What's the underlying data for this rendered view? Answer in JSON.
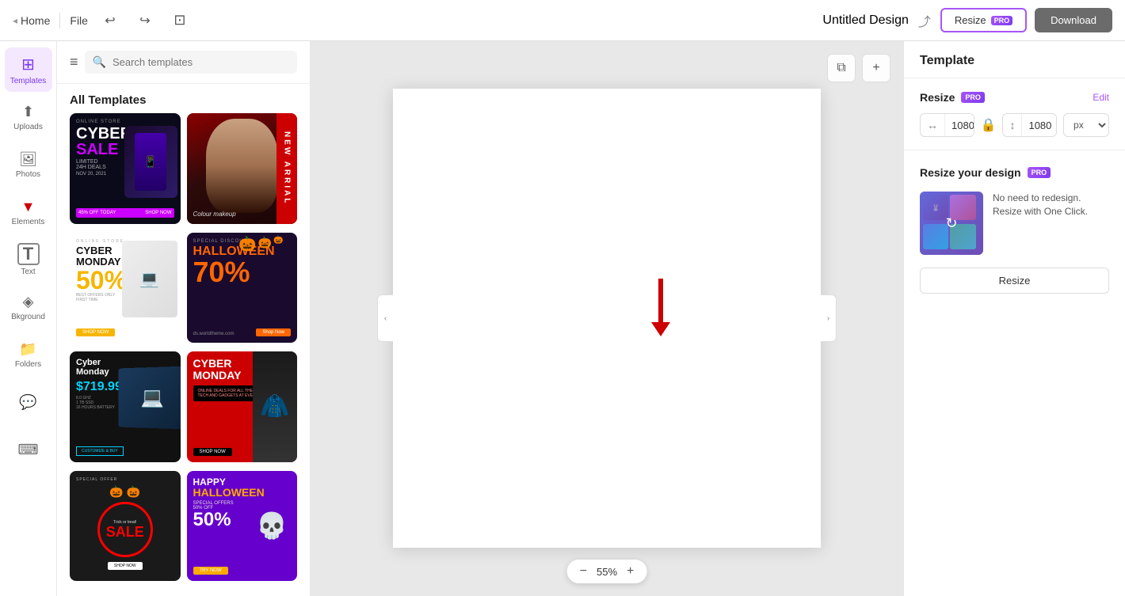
{
  "topbar": {
    "home_label": "Home",
    "file_label": "File",
    "undo_icon": "↩",
    "redo_icon": "↪",
    "doc_icon": "⬜",
    "title": "Untitled Design",
    "share_icon": "⤴",
    "resize_label": "Resize",
    "pro_badge": "PRO",
    "download_label": "Download"
  },
  "sidebar": {
    "items": [
      {
        "id": "templates",
        "label": "Templates",
        "icon": "⊞",
        "active": true
      },
      {
        "id": "uploads",
        "label": "Uploads",
        "icon": "↑"
      },
      {
        "id": "photos",
        "label": "Photos",
        "icon": "🖼"
      },
      {
        "id": "elements",
        "label": "Elements",
        "icon": "✦"
      },
      {
        "id": "text",
        "label": "Text",
        "icon": "T"
      },
      {
        "id": "background",
        "label": "Bkground",
        "icon": "◈"
      },
      {
        "id": "folders",
        "label": "Folders",
        "icon": "🗂"
      },
      {
        "id": "comments",
        "label": "",
        "icon": "💬"
      },
      {
        "id": "keyboard",
        "label": "",
        "icon": "⌨"
      }
    ]
  },
  "templates_panel": {
    "search_placeholder": "Search templates",
    "title": "All Templates",
    "hamburger_icon": "≡",
    "templates": [
      {
        "id": "cyber-sale",
        "type": "cyber_sale",
        "title": "Cyber Sale 45% Off"
      },
      {
        "id": "new-arrival",
        "type": "new_arrival",
        "title": "New Arrival Makeup"
      },
      {
        "id": "cyber-monday-1",
        "type": "cyber_monday_white",
        "title": "Cyber Monday 50%"
      },
      {
        "id": "halloween-70",
        "type": "halloween_70",
        "title": "Halloween 70%"
      },
      {
        "id": "cyber-monday-laptop",
        "type": "cyber_mon_laptop",
        "title": "Cyber Monday Laptop"
      },
      {
        "id": "cyber-monday-red",
        "type": "cyber_mon_red",
        "title": "Cyber Monday Red"
      },
      {
        "id": "trick-treat",
        "type": "trick_treat",
        "title": "Trick or Treat Sale"
      },
      {
        "id": "happy-halloween",
        "type": "happy_halloween",
        "title": "Happy Halloween 50% Off"
      }
    ]
  },
  "canvas": {
    "zoom_level": "55%",
    "zoom_in_label": "+",
    "zoom_out_label": "−",
    "copy_icon": "⧉",
    "add_icon": "+"
  },
  "right_panel": {
    "title": "Template",
    "resize": {
      "label": "Resize",
      "pro_badge": "PRO",
      "edit_label": "Edit",
      "width": "1080",
      "height": "1080",
      "unit": "px",
      "lock_icon": "🔒"
    },
    "resize_design": {
      "title": "Resize your design",
      "pro_badge": "PRO",
      "description": "No need to redesign. Resize with One Click.",
      "button_label": "Resize"
    }
  }
}
